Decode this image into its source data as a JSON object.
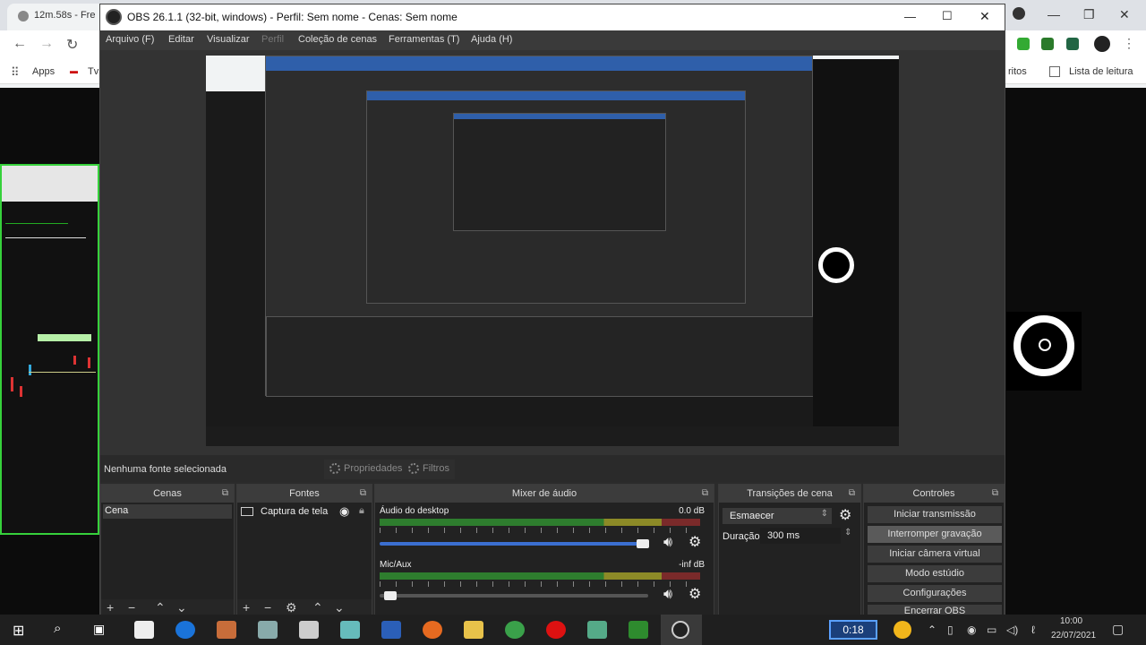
{
  "chrome": {
    "tab_title": "12m.58s - Fre",
    "tab_partial": "Lista de leitura",
    "bookmarks": {
      "apps": "Apps",
      "tv": "Tv",
      "favorites_partial": "ritos"
    }
  },
  "obs": {
    "title": "OBS 26.1.1 (32-bit, windows) - Perfil: Sem nome - Cenas: Sem nome",
    "menu": [
      "Arquivo (F)",
      "Editar",
      "Visualizar",
      "Perfil",
      "Coleção de cenas",
      "Ferramentas (T)",
      "Ajuda (H)"
    ],
    "no_source": "Nenhuma fonte selecionada",
    "properties": "Propriedades",
    "filters": "Filtros",
    "docks": {
      "scenes": {
        "title": "Cenas",
        "items": [
          "Cena"
        ]
      },
      "sources": {
        "title": "Fontes",
        "items": [
          "Captura de tela"
        ]
      },
      "mixer": {
        "title": "Mixer de áudio",
        "channels": [
          {
            "name": "Áudio do desktop",
            "db": "0.0 dB",
            "volume": 0.98
          },
          {
            "name": "Mic/Aux",
            "db": "-inf dB",
            "volume": 0.04
          }
        ],
        "scale": [
          "-60",
          "-55",
          "-50",
          "-45",
          "-40",
          "-35",
          "-30",
          "-25",
          "-20",
          "-15",
          "-10",
          "-5",
          "0"
        ]
      },
      "transitions": {
        "title": "Transições de cena",
        "selected": "Esmaecer",
        "duration_label": "Duração",
        "duration_value": "300 ms"
      },
      "controls": {
        "title": "Controles",
        "buttons": [
          "Iniciar transmissão",
          "Interromper gravação",
          "Iniciar câmera virtual",
          "Modo estúdio",
          "Configurações",
          "Encerrar OBS"
        ]
      }
    }
  },
  "taskbar": {
    "rec_time": "0:18",
    "time": "10:00",
    "date": "22/07/2021"
  }
}
